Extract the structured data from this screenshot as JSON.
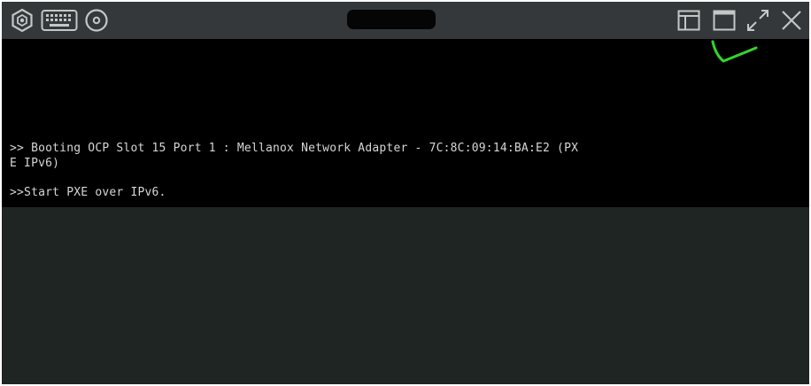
{
  "toolbar": {
    "left_icons": [
      "settings-hex-icon",
      "keyboard-icon",
      "disc-icon"
    ],
    "right_icons": [
      "layout-split-icon",
      "window-icon",
      "fullscreen-icon",
      "close-icon"
    ]
  },
  "console": {
    "lines": [
      ">> Booting OCP Slot 15 Port 1 : Mellanox Network Adapter - 7C:8C:09:14:BA:E2 (PX",
      "E IPv6)",
      ">>Start PXE over IPv6."
    ]
  },
  "colors": {
    "toolbar_bg": "#34383a",
    "console_bg": "#000000",
    "console_text": "#d6d6d6",
    "canvas_bg": "#1f2523",
    "annotation": "#33d52a"
  }
}
